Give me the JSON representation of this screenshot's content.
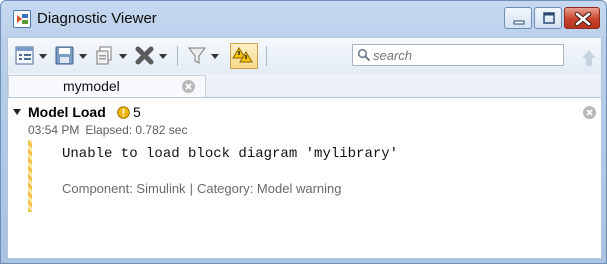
{
  "window": {
    "title": "Diagnostic Viewer",
    "icons": {
      "app": "model-icon",
      "minimize": "minimize-icon",
      "maximize": "maximize-icon",
      "close": "close-icon"
    },
    "colors": {
      "close_button": "#c7452e",
      "titlebar": "#c6d9f1"
    }
  },
  "toolbar": {
    "items": [
      {
        "icon": "report-view-icon",
        "menu": true
      },
      {
        "icon": "save-icon",
        "menu": true
      },
      {
        "icon": "copy-icon",
        "menu": true
      },
      {
        "icon": "clear-icon",
        "menu": true
      },
      {
        "icon": "filter-icon",
        "menu": true
      },
      {
        "icon": "group-warnings-icon",
        "menu": false
      }
    ],
    "search": {
      "placeholder": "search",
      "value": ""
    },
    "up_icon": "arrow-up-icon"
  },
  "tabs": [
    {
      "label": "mymodel",
      "close_icon": "close-icon"
    }
  ],
  "section": {
    "title": "Model Load",
    "warning_count": "5",
    "time": "03:54 PM",
    "elapsed": "Elapsed: 0.782 sec",
    "colors": {
      "warning": "#e0a400"
    }
  },
  "message": {
    "text": "Unable to load block diagram 'mylibrary'",
    "component": "Component: Simulink",
    "separator": "|",
    "category": "Category: Model warning",
    "colors": {
      "stripe": "#f2c04a"
    }
  }
}
